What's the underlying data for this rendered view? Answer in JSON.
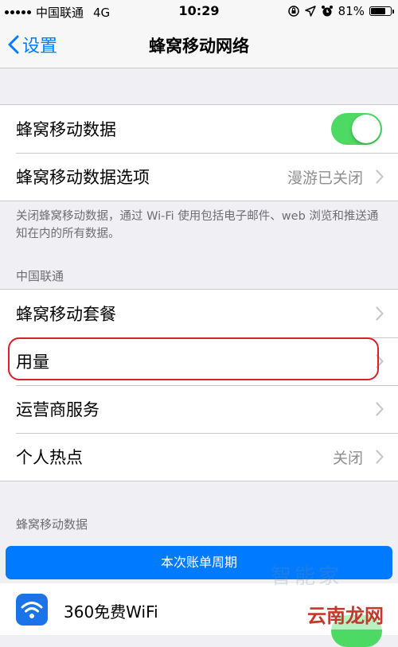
{
  "status_bar": {
    "carrier": "中国联通",
    "network": "4G",
    "time": "10:29",
    "battery": "81%",
    "battery_level": 0.81
  },
  "nav": {
    "back_label": "设置",
    "title": "蜂窝移动网络"
  },
  "group1": {
    "cellular_data_label": "蜂窝移动数据",
    "cellular_data_on": true,
    "options_label": "蜂窝移动数据选项",
    "options_value": "漫游已关闭"
  },
  "footnote": "关闭蜂窝移动数据，通过 Wi-Fi 使用包括电子邮件、web 浏览和推送通知在内的所有数据。",
  "carrier_section": {
    "header": "中国联通",
    "items": [
      {
        "label": "蜂窝移动套餐",
        "value": ""
      },
      {
        "label": "用量",
        "value": ""
      },
      {
        "label": "运营商服务",
        "value": ""
      },
      {
        "label": "个人热点",
        "value": "关闭"
      }
    ]
  },
  "usage_section": {
    "header": "蜂窝移动数据",
    "period_button": "本次账单周期",
    "apps": [
      {
        "name": "360免费WiFi",
        "enabled": true
      }
    ]
  },
  "watermark": {
    "faded": "智能家",
    "brand": "云南龙网"
  },
  "colors": {
    "accent": "#007aff",
    "toggle_on": "#4cd964",
    "highlight": "#d6212a",
    "background": "#efeff4"
  }
}
